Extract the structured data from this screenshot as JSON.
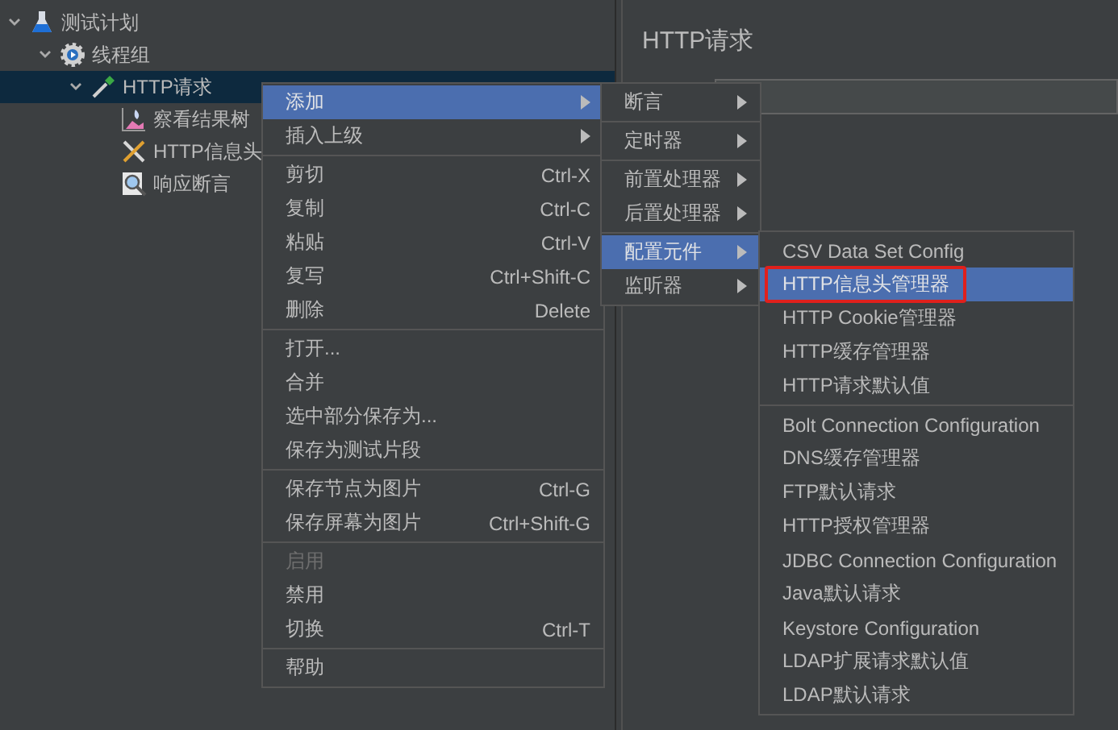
{
  "tree": [
    {
      "label": "测试计划",
      "kind": "flask",
      "expanded": true,
      "selected": false,
      "children": [
        {
          "label": "线程组",
          "kind": "gear",
          "expanded": true,
          "selected": false,
          "children": [
            {
              "label": "HTTP请求",
              "kind": "dropper",
              "expanded": true,
              "selected": true,
              "children": [
                {
                  "label": "察看结果树",
                  "kind": "chart",
                  "selected": false
                },
                {
                  "label": "HTTP信息头",
                  "kind": "tools",
                  "selected": false
                },
                {
                  "label": "响应断言",
                  "kind": "magnifier",
                  "selected": false
                }
              ]
            }
          ]
        }
      ]
    }
  ],
  "panel": {
    "title": "HTTP请求"
  },
  "context_menu": [
    {
      "kind": "item",
      "label": "添加",
      "submenu": true,
      "selected": true,
      "disabled": false
    },
    {
      "kind": "item",
      "label": "插入上级",
      "submenu": true,
      "selected": false,
      "disabled": false
    },
    {
      "kind": "separator"
    },
    {
      "kind": "item",
      "label": "剪切",
      "shortcut": "Ctrl-X",
      "selected": false,
      "disabled": false
    },
    {
      "kind": "item",
      "label": "复制",
      "shortcut": "Ctrl-C",
      "selected": false,
      "disabled": false
    },
    {
      "kind": "item",
      "label": "粘贴",
      "shortcut": "Ctrl-V",
      "selected": false,
      "disabled": false
    },
    {
      "kind": "item",
      "label": "复写",
      "shortcut": "Ctrl+Shift-C",
      "selected": false,
      "disabled": false
    },
    {
      "kind": "item",
      "label": "删除",
      "shortcut": "Delete",
      "selected": false,
      "disabled": false
    },
    {
      "kind": "separator"
    },
    {
      "kind": "item",
      "label": "打开...",
      "selected": false,
      "disabled": false
    },
    {
      "kind": "item",
      "label": "合并",
      "selected": false,
      "disabled": false
    },
    {
      "kind": "item",
      "label": "选中部分保存为...",
      "selected": false,
      "disabled": false
    },
    {
      "kind": "item",
      "label": "保存为测试片段",
      "selected": false,
      "disabled": false
    },
    {
      "kind": "separator"
    },
    {
      "kind": "item",
      "label": "保存节点为图片",
      "shortcut": "Ctrl-G",
      "selected": false,
      "disabled": false
    },
    {
      "kind": "item",
      "label": "保存屏幕为图片",
      "shortcut": "Ctrl+Shift-G",
      "selected": false,
      "disabled": false
    },
    {
      "kind": "separator"
    },
    {
      "kind": "item",
      "label": "启用",
      "selected": false,
      "disabled": true
    },
    {
      "kind": "item",
      "label": "禁用",
      "selected": false,
      "disabled": false
    },
    {
      "kind": "item",
      "label": "切换",
      "shortcut": "Ctrl-T",
      "selected": false,
      "disabled": false
    },
    {
      "kind": "separator"
    },
    {
      "kind": "item",
      "label": "帮助",
      "selected": false,
      "disabled": false
    }
  ],
  "add_submenu": [
    {
      "kind": "item",
      "label": "断言",
      "submenu": true,
      "selected": false
    },
    {
      "kind": "separator"
    },
    {
      "kind": "item",
      "label": "定时器",
      "submenu": true,
      "selected": false
    },
    {
      "kind": "separator"
    },
    {
      "kind": "item",
      "label": "前置处理器",
      "submenu": true,
      "selected": false
    },
    {
      "kind": "item",
      "label": "后置处理器",
      "submenu": true,
      "selected": false
    },
    {
      "kind": "separator"
    },
    {
      "kind": "item",
      "label": "配置元件",
      "submenu": true,
      "selected": true
    },
    {
      "kind": "item",
      "label": "监听器",
      "submenu": true,
      "selected": false
    }
  ],
  "config_submenu": [
    {
      "kind": "item",
      "label": "CSV Data Set Config",
      "selected": false,
      "outlined": false
    },
    {
      "kind": "item",
      "label": "HTTP信息头管理器",
      "selected": true,
      "outlined": true
    },
    {
      "kind": "item",
      "label": "HTTP Cookie管理器",
      "selected": false,
      "outlined": false
    },
    {
      "kind": "item",
      "label": "HTTP缓存管理器",
      "selected": false,
      "outlined": false
    },
    {
      "kind": "item",
      "label": "HTTP请求默认值",
      "selected": false,
      "outlined": false
    },
    {
      "kind": "separator"
    },
    {
      "kind": "item",
      "label": "Bolt Connection Configuration",
      "selected": false,
      "outlined": false
    },
    {
      "kind": "item",
      "label": "DNS缓存管理器",
      "selected": false,
      "outlined": false
    },
    {
      "kind": "item",
      "label": "FTP默认请求",
      "selected": false,
      "outlined": false
    },
    {
      "kind": "item",
      "label": "HTTP授权管理器",
      "selected": false,
      "outlined": false
    },
    {
      "kind": "item",
      "label": "JDBC Connection Configuration",
      "selected": false,
      "outlined": false
    },
    {
      "kind": "item",
      "label": "Java默认请求",
      "selected": false,
      "outlined": false
    },
    {
      "kind": "item",
      "label": "Keystore Configuration",
      "selected": false,
      "outlined": false
    },
    {
      "kind": "item",
      "label": "LDAP扩展请求默认值",
      "selected": false,
      "outlined": false
    },
    {
      "kind": "item",
      "label": "LDAP默认请求",
      "selected": false,
      "outlined": false
    }
  ]
}
